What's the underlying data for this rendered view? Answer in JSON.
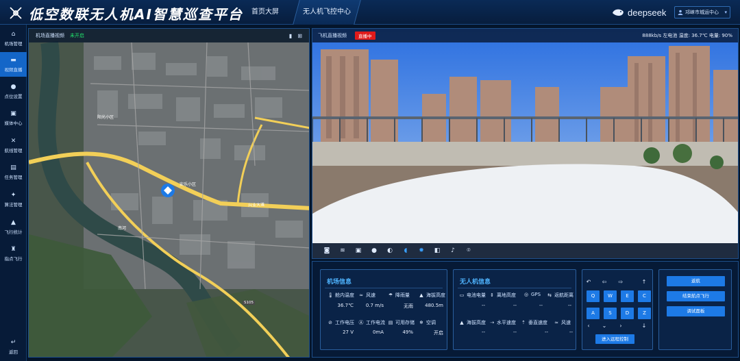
{
  "header": {
    "title": "低空数联无人机AI智慧巡查平台",
    "tabs": [
      {
        "label": "首页大屏"
      },
      {
        "label": "无人机飞控中心"
      }
    ],
    "brand": "deepseek",
    "user": "邛崃市城运中心"
  },
  "sidebar": {
    "items": [
      {
        "label": "机场管理",
        "icon": "drone-station-icon"
      },
      {
        "label": "视频直播",
        "icon": "video-icon"
      },
      {
        "label": "点位设置",
        "icon": "location-pin-icon"
      },
      {
        "label": "媒体中心",
        "icon": "media-icon"
      },
      {
        "label": "航线管理",
        "icon": "route-icon"
      },
      {
        "label": "任务管理",
        "icon": "task-icon"
      },
      {
        "label": "算法管理",
        "icon": "algorithm-icon"
      },
      {
        "label": "飞行统计",
        "icon": "stats-icon"
      },
      {
        "label": "指点飞行",
        "icon": "point-flight-icon"
      }
    ],
    "back_label": "返回"
  },
  "map_panel": {
    "title": "机场直播视频",
    "status": "未开启"
  },
  "video_panel": {
    "title": "飞机直播视频",
    "badge": "直播中",
    "stats": "888kb/s   左电池 温度: 36.7℃ 电量: 90%"
  },
  "airport_info": {
    "title": "机场信息",
    "items": [
      {
        "label": "舱内温度",
        "value": "36.7℃"
      },
      {
        "label": "风速",
        "value": "0.7 m/s"
      },
      {
        "label": "降雨量",
        "value": "无雨"
      },
      {
        "label": "海拔高度",
        "value": "480.5m"
      },
      {
        "label": "工作电压",
        "value": "27 V"
      },
      {
        "label": "工作电流",
        "value": "0mA"
      },
      {
        "label": "可用存储",
        "value": "49%"
      },
      {
        "label": "空调",
        "value": "开启"
      }
    ]
  },
  "drone_info": {
    "title": "无人机信息",
    "items": [
      {
        "label": "电池电量",
        "value": "--"
      },
      {
        "label": "离地高度",
        "value": "--"
      },
      {
        "label": "GPS",
        "value": "--"
      },
      {
        "label": "返航距离",
        "value": "--"
      },
      {
        "label": "海拔高度",
        "value": "--"
      },
      {
        "label": "水平速度",
        "value": "--"
      },
      {
        "label": "垂直速度",
        "value": "--"
      },
      {
        "label": "风速",
        "value": "--"
      }
    ]
  },
  "flight_keys": {
    "row1": [
      "Q",
      "W",
      "E",
      "C"
    ],
    "row2": [
      "A",
      "S",
      "D",
      "Z"
    ],
    "remote_button": "进入远程控制"
  },
  "actions": [
    {
      "label": "返航"
    },
    {
      "label": "结束航点飞行"
    },
    {
      "label": "调试面板"
    }
  ],
  "map_labels": [
    {
      "text": "安乐小区"
    },
    {
      "text": "阳光小区"
    },
    {
      "text": "兴业大道"
    },
    {
      "text": "南河"
    },
    {
      "text": "S105"
    }
  ],
  "colors": {
    "accent": "#1d7ae6",
    "status_green": "#21e36b",
    "live_red": "#e01a1a",
    "title_blue": "#4fb4ff"
  }
}
